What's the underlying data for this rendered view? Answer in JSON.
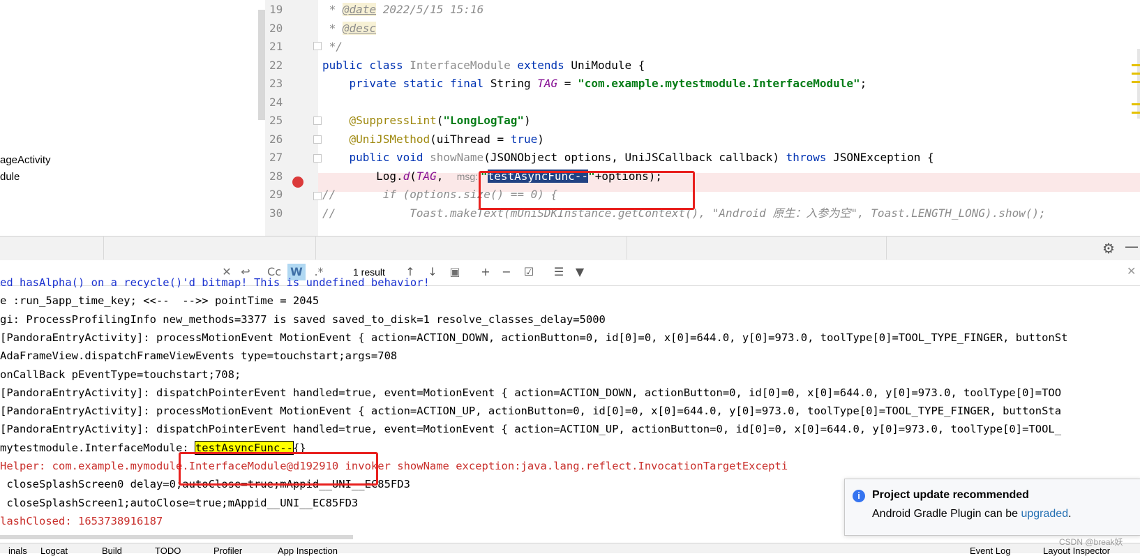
{
  "project_tree": {
    "items": [
      "ageActivity",
      "dule"
    ]
  },
  "editor": {
    "line_numbers": [
      "19",
      "20",
      "21",
      "22",
      "23",
      "24",
      "25",
      "26",
      "27",
      "28",
      "29",
      "30"
    ],
    "lines": [
      [
        {
          "t": " * ",
          "c": "doc"
        },
        {
          "t": "@date",
          "c": "doctag"
        },
        {
          "t": " 2022/5/15 15:16",
          "c": "doc"
        }
      ],
      [
        {
          "t": " * ",
          "c": "doc"
        },
        {
          "t": "@desc",
          "c": "doctag"
        }
      ],
      [
        {
          "t": " */",
          "c": "doc"
        }
      ],
      [
        {
          "t": "public class ",
          "c": "kw"
        },
        {
          "t": "InterfaceModule ",
          "c": "mname"
        },
        {
          "t": "extends ",
          "c": "kw"
        },
        {
          "t": "UniModule {",
          "c": "cls"
        }
      ],
      [
        {
          "t": "    private static final ",
          "c": "kw"
        },
        {
          "t": "String ",
          "c": "cls"
        },
        {
          "t": "TAG",
          "c": "field"
        },
        {
          "t": " = ",
          "c": "cls"
        },
        {
          "t": "\"com.example.mytestmodule.InterfaceModule\"",
          "c": "str"
        },
        {
          "t": ";",
          "c": "cls"
        }
      ],
      [],
      [
        {
          "t": "    @SuppressLint",
          "c": "ann"
        },
        {
          "t": "(",
          "c": "cls"
        },
        {
          "t": "\"LongLogTag\"",
          "c": "str"
        },
        {
          "t": ")",
          "c": "cls"
        }
      ],
      [
        {
          "t": "    @UniJSMethod",
          "c": "ann"
        },
        {
          "t": "(uiThread = ",
          "c": "cls"
        },
        {
          "t": "true",
          "c": "kw"
        },
        {
          "t": ")",
          "c": "cls"
        }
      ],
      [
        {
          "t": "    public void ",
          "c": "kw"
        },
        {
          "t": "showName",
          "c": "mname"
        },
        {
          "t": "(JSONObject options, UniJSCallback callback) ",
          "c": "cls"
        },
        {
          "t": "throws ",
          "c": "kw"
        },
        {
          "t": "JSONException {",
          "c": "cls"
        }
      ],
      [
        {
          "t": "        Log.",
          "c": "cls"
        },
        {
          "t": "d",
          "c": "field"
        },
        {
          "t": "(",
          "c": "cls"
        },
        {
          "t": "TAG",
          "c": "field"
        },
        {
          "t": ",  ",
          "c": "cls"
        },
        {
          "t": "msg: ",
          "c": "hint"
        },
        {
          "t": "\"",
          "c": "str"
        },
        {
          "t": "testAsyncFunc--",
          "c": "sel"
        },
        {
          "t": "\"",
          "c": "str"
        },
        {
          "t": "+options);",
          "c": "cls"
        }
      ],
      [
        {
          "t": "//       if (options.size() == 0) {",
          "c": "cmt"
        }
      ],
      [
        {
          "t": "//           Toast.makeText(mUniSDKInstance.getContext(), \"Android 原生：入参为空\", Toast.LENGTH_LONG).show();",
          "c": "cmt"
        }
      ]
    ]
  },
  "search": {
    "case_label": "Cc",
    "words_label": "W",
    "regex_label": ".*",
    "result_count": "1 result"
  },
  "log": [
    {
      "text": "ed hasAlpha() on a recycle()'d bitmap! This is undefined behavior!",
      "color": "blue"
    },
    {
      "text": "e :run_5app_time_key; <<--  -->> pointTime = 2045",
      "color": "black"
    },
    {
      "text": "gi: ProcessProfilingInfo new_methods=3377 is saved saved_to_disk=1 resolve_classes_delay=5000",
      "color": "black"
    },
    {
      "text": "[PandoraEntryActivity]: processMotionEvent MotionEvent { action=ACTION_DOWN, actionButton=0, id[0]=0, x[0]=644.0, y[0]=973.0, toolType[0]=TOOL_TYPE_FINGER, buttonSt",
      "color": "black"
    },
    {
      "text": "AdaFrameView.dispatchFrameViewEvents type=touchstart;args=708",
      "color": "black"
    },
    {
      "text": "onCallBack pEventType=touchstart;708;",
      "color": "black"
    },
    {
      "text": "[PandoraEntryActivity]: dispatchPointerEvent handled=true, event=MotionEvent { action=ACTION_DOWN, actionButton=0, id[0]=0, x[0]=644.0, y[0]=973.0, toolType[0]=TOO",
      "color": "black"
    },
    {
      "text": "[PandoraEntryActivity]: processMotionEvent MotionEvent { action=ACTION_UP, actionButton=0, id[0]=0, x[0]=644.0, y[0]=973.0, toolType[0]=TOOL_TYPE_FINGER, buttonSta",
      "color": "black"
    },
    {
      "text": "[PandoraEntryActivity]: dispatchPointerEvent handled=true, event=MotionEvent { action=ACTION_UP, actionButton=0, id[0]=0, x[0]=644.0, y[0]=973.0, toolType[0]=TOOL_",
      "color": "black"
    },
    {
      "text": "mytestmodule.InterfaceModule: ",
      "highlight": "testAsyncFunc--",
      "suffix": "{}",
      "color": "black"
    },
    {
      "text": "Helper: com.example.mymodule.InterfaceModule@d192910 invoker showName exception:java.lang.reflect.InvocationTargetExcepti",
      "color": "red"
    },
    {
      "text": " closeSplashScreen0 delay=0;autoClose=true;mAppid__UNI__EC85FD3",
      "color": "black"
    },
    {
      "text": " closeSplashScreen1;autoClose=true;mAppid__UNI__EC85FD3",
      "color": "black"
    },
    {
      "text": "lashClosed: 1653738916187",
      "color": "red"
    }
  ],
  "notification": {
    "title": "Project update recommended",
    "body_prefix": "Android Gradle Plugin can be ",
    "link": "upgraded",
    "body_suffix": "."
  },
  "watermark": "CSDN @break妖",
  "status_bar": {
    "items": [
      "inals",
      "Logcat",
      "Build",
      "TODO",
      "Profiler",
      "App Inspection",
      "Event Log",
      "Layout Inspector"
    ]
  },
  "colors": {
    "accent": "#3574f0",
    "annotation_box": "#e8201e",
    "breakpoint": "#db3a3a",
    "selection": "#214283",
    "search_highlight": "#ffff00"
  }
}
